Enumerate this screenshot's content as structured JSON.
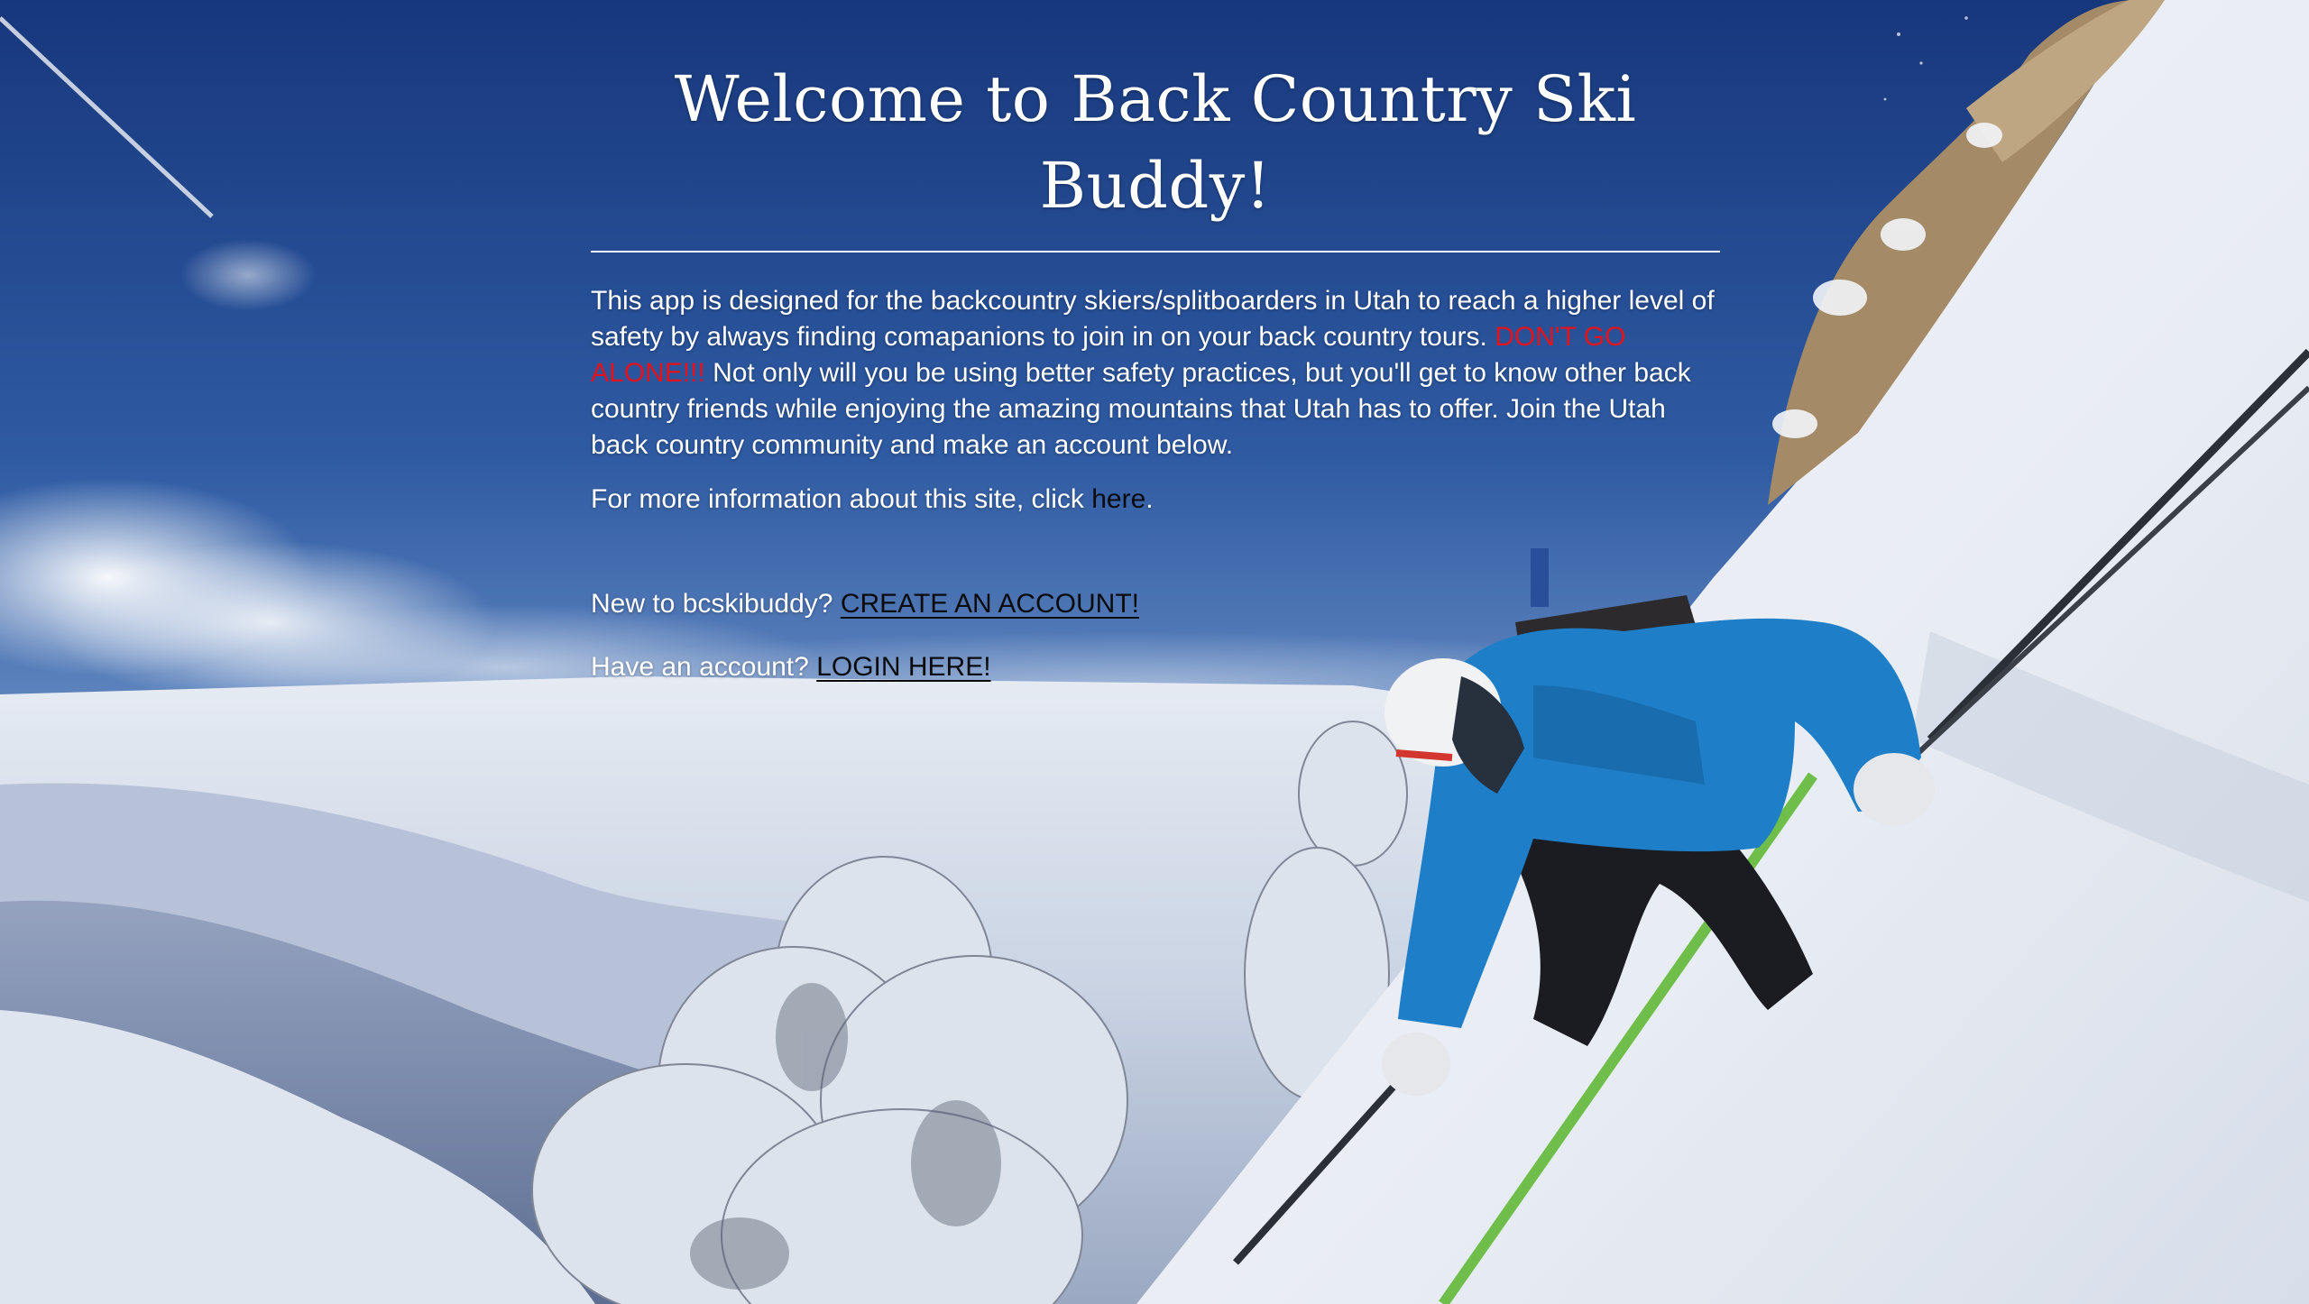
{
  "page": {
    "title": "Welcome to Back Country Ski Buddy!"
  },
  "intro": {
    "text_before": "This app is designed for the backcountry skiers/splitboarders in Utah to reach a higher level of safety by always finding comapanions to join in on your back country tours.",
    "warning": "DON'T GO ALONE!!!",
    "text_after": "Not only will you be using better safety practices, but you'll get to know other back country friends while enjoying the amazing mountains that Utah has to offer. Join the Utah back country community and make an account below."
  },
  "more_info": {
    "prefix": "For more information about this site, click",
    "link_label": "here",
    "suffix": "."
  },
  "signup": {
    "prompt": "New to bcskibuddy?",
    "link_label": "CREATE AN ACCOUNT!"
  },
  "login": {
    "prompt": "Have an account?",
    "link_label": "LOGIN HERE!"
  },
  "colors": {
    "warning": "#e3121b",
    "link": "#0b0b0b",
    "text": "#ffffff",
    "sky_top": "#1b3f86",
    "sky_bottom": "#5f86c1"
  },
  "background": {
    "icon": "skier-on-mountain-photo"
  }
}
